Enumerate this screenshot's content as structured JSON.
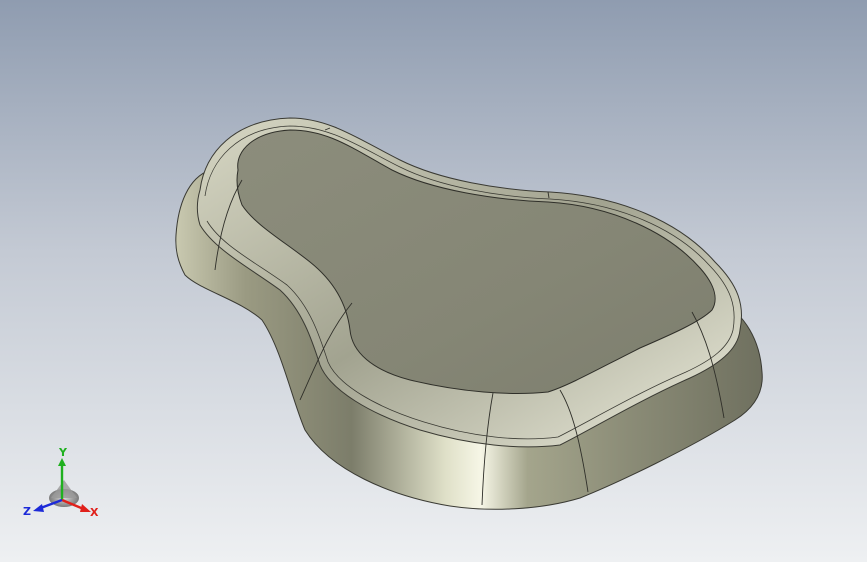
{
  "viewport": {
    "background_top": "#b7bfcb",
    "background_bottom": "#e6e8ec",
    "model_color": "#8d8e7e"
  },
  "triad": {
    "x_label": "X",
    "y_label": "Y",
    "z_label": "Z",
    "x_color": "#e0201a",
    "y_color": "#1fb01f",
    "z_color": "#1c2ad8"
  }
}
